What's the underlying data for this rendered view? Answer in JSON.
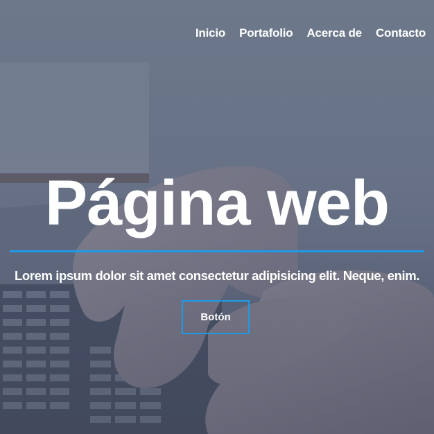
{
  "nav": {
    "items": [
      {
        "label": "Inicio"
      },
      {
        "label": "Portafolio"
      },
      {
        "label": "Acerca de"
      },
      {
        "label": "Contacto"
      }
    ]
  },
  "hero": {
    "title": "Página web",
    "subtitle": "Lorem ipsum dolor sit amet consectetur adipisicing elit. Neque, enim.",
    "button_label": "Botón"
  },
  "colors": {
    "accent": "#1e9be8",
    "text": "#ffffff",
    "overlay": "#485468"
  }
}
